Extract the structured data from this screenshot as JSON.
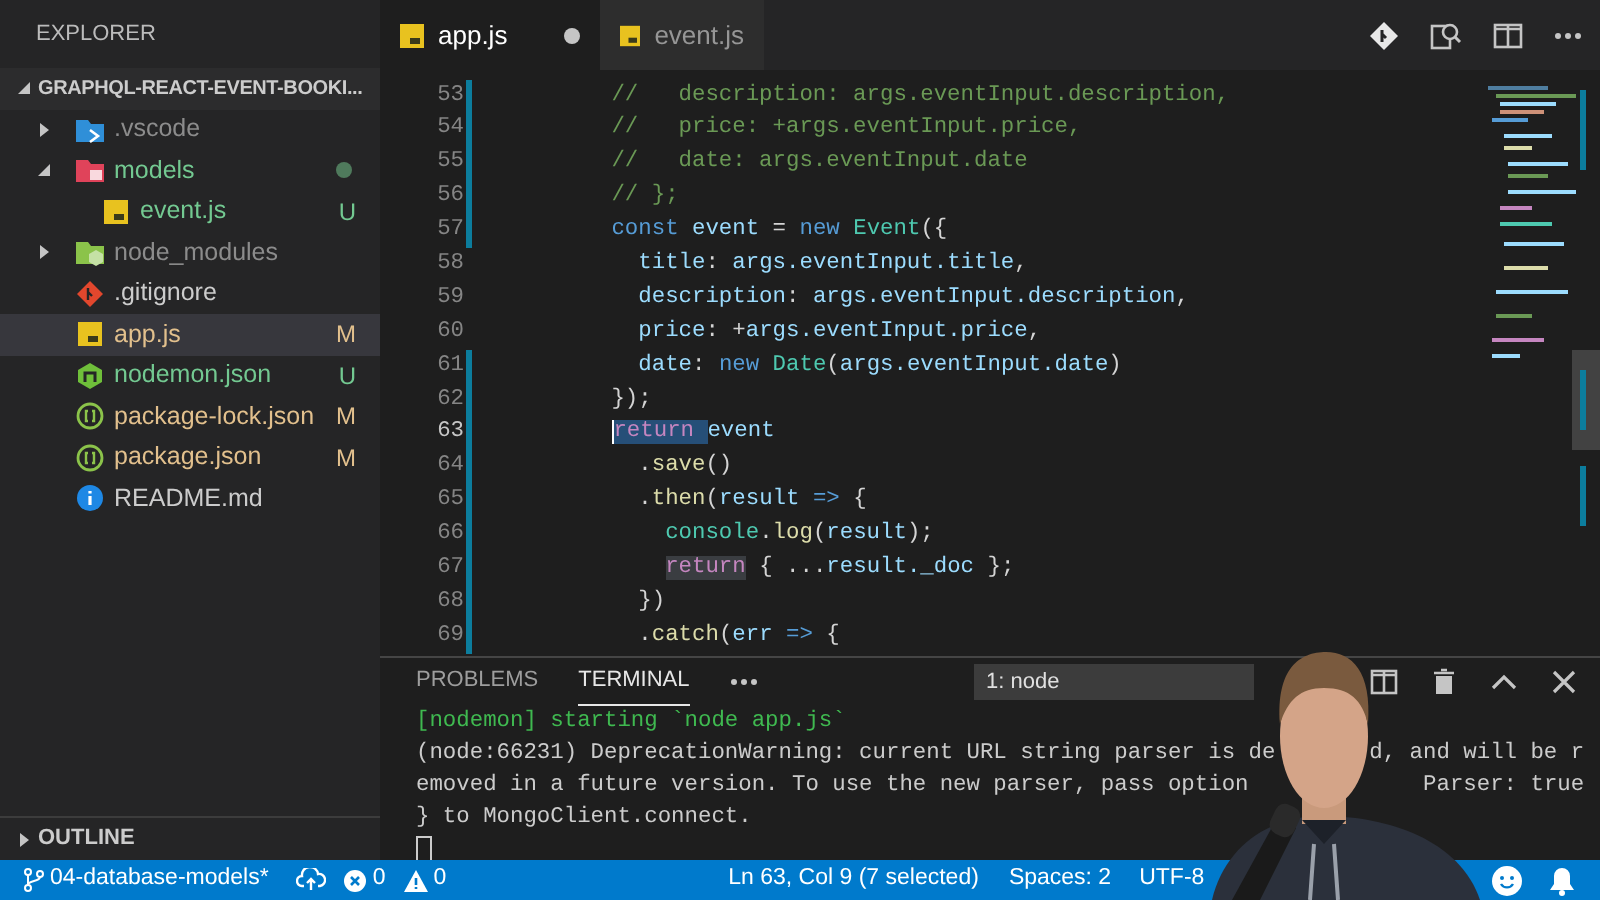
{
  "sidebar": {
    "title": "EXPLORER",
    "root": {
      "label": "GRAPHQL-REACT-EVENT-BOOKI...",
      "expanded": true
    },
    "items": [
      {
        "label": ".vscode",
        "expanded": false,
        "selected": false,
        "color": "#8c8c8c"
      },
      {
        "label": "models",
        "expanded": true,
        "selected": false,
        "color": "#73c991",
        "changed": true,
        "children": [
          {
            "label": "event.js",
            "selected": false,
            "color": "#73c991",
            "badge": "U"
          }
        ]
      },
      {
        "label": "node_modules",
        "expanded": false,
        "selected": false,
        "color": "#8c8c8c"
      },
      {
        "label": ".gitignore",
        "selected": false,
        "color": "#cccccc"
      },
      {
        "label": "app.js",
        "selected": true,
        "color": "#e2c08d",
        "badge": "M"
      },
      {
        "label": "nodemon.json",
        "selected": false,
        "color": "#73c991",
        "badge": "U"
      },
      {
        "label": "package-lock.json",
        "selected": false,
        "color": "#e2c08d",
        "badge": "M"
      },
      {
        "label": "package.json",
        "selected": false,
        "color": "#e2c08d",
        "badge": "M"
      },
      {
        "label": "README.md",
        "selected": false,
        "color": "#cccccc"
      }
    ],
    "outline": {
      "label": "OUTLINE",
      "expanded": false
    }
  },
  "tabs": [
    {
      "label": "app.js",
      "selected": true,
      "dirty": true
    },
    {
      "label": "event.js",
      "selected": false,
      "dirty": false
    }
  ],
  "code_lines": [
    {
      "number": "53",
      "modified": true,
      "current": false,
      "tokens": [
        {
          "kind": "comment",
          "text": "        //   description: args.eventInput.description,"
        }
      ]
    },
    {
      "number": "54",
      "modified": true,
      "current": false,
      "tokens": [
        {
          "kind": "comment",
          "text": "        //   price: +args.eventInput.price,"
        }
      ]
    },
    {
      "number": "55",
      "modified": true,
      "current": false,
      "tokens": [
        {
          "kind": "comment",
          "text": "        //   date: args.eventInput.date"
        }
      ]
    },
    {
      "number": "56",
      "modified": true,
      "current": false,
      "tokens": [
        {
          "kind": "comment",
          "text": "        // };"
        }
      ]
    },
    {
      "number": "57",
      "modified": true,
      "current": false,
      "tokens": [
        {
          "kind": "keyword",
          "text": "        const"
        },
        {
          "kind": "variable",
          "text": " event"
        },
        {
          "kind": "plain",
          "text": " = "
        },
        {
          "kind": "keyword",
          "text": "new"
        },
        {
          "kind": "class",
          "text": " Event"
        },
        {
          "kind": "plain",
          "text": "({"
        }
      ]
    },
    {
      "number": "58",
      "modified": false,
      "current": false,
      "tokens": [
        {
          "kind": "variable",
          "text": "          title"
        },
        {
          "kind": "plain",
          "text": ": "
        },
        {
          "kind": "variable",
          "text": "args.eventInput.title"
        },
        {
          "kind": "plain",
          "text": ","
        }
      ]
    },
    {
      "number": "59",
      "modified": false,
      "current": false,
      "tokens": [
        {
          "kind": "variable",
          "text": "          description"
        },
        {
          "kind": "plain",
          "text": ": "
        },
        {
          "kind": "variable",
          "text": "args.eventInput.description"
        },
        {
          "kind": "plain",
          "text": ","
        }
      ]
    },
    {
      "number": "60",
      "modified": false,
      "current": false,
      "tokens": [
        {
          "kind": "variable",
          "text": "          price"
        },
        {
          "kind": "plain",
          "text": ": +"
        },
        {
          "kind": "variable",
          "text": "args.eventInput.price"
        },
        {
          "kind": "plain",
          "text": ","
        }
      ]
    },
    {
      "number": "61",
      "modified": true,
      "current": false,
      "tokens": [
        {
          "kind": "variable",
          "text": "          date"
        },
        {
          "kind": "plain",
          "text": ": "
        },
        {
          "kind": "keyword",
          "text": "new"
        },
        {
          "kind": "class",
          "text": " Date"
        },
        {
          "kind": "plain",
          "text": "("
        },
        {
          "kind": "variable",
          "text": "args.eventInput.date"
        },
        {
          "kind": "plain",
          "text": ")"
        }
      ]
    },
    {
      "number": "62",
      "modified": true,
      "current": false,
      "tokens": [
        {
          "kind": "plain",
          "text": "        });"
        }
      ]
    },
    {
      "number": "63",
      "modified": true,
      "current": true,
      "tokens": [
        {
          "kind": "control",
          "text": "        return ",
          "in_selection": true
        },
        {
          "kind": "variable",
          "text": "event"
        }
      ]
    },
    {
      "number": "64",
      "modified": true,
      "current": false,
      "tokens": [
        {
          "kind": "plain",
          "text": "          ."
        },
        {
          "kind": "function",
          "text": "save"
        },
        {
          "kind": "plain",
          "text": "()"
        }
      ]
    },
    {
      "number": "65",
      "modified": true,
      "current": false,
      "tokens": [
        {
          "kind": "plain",
          "text": "          ."
        },
        {
          "kind": "function",
          "text": "then"
        },
        {
          "kind": "plain",
          "text": "("
        },
        {
          "kind": "variable",
          "text": "result"
        },
        {
          "kind": "keyword",
          "text": " =>"
        },
        {
          "kind": "plain",
          "text": " {"
        }
      ]
    },
    {
      "number": "66",
      "modified": true,
      "current": false,
      "tokens": [
        {
          "kind": "class",
          "text": "            console"
        },
        {
          "kind": "plain",
          "text": "."
        },
        {
          "kind": "function",
          "text": "log"
        },
        {
          "kind": "plain",
          "text": "("
        },
        {
          "kind": "variable",
          "text": "result"
        },
        {
          "kind": "plain",
          "text": ");"
        }
      ]
    },
    {
      "number": "67",
      "modified": true,
      "current": false,
      "tokens": [
        {
          "kind": "control",
          "text": "            return",
          "word_highlight": true
        },
        {
          "kind": "plain",
          "text": " { ..."
        },
        {
          "kind": "variable",
          "text": "result._doc"
        },
        {
          "kind": "plain",
          "text": " };"
        }
      ]
    },
    {
      "number": "68",
      "modified": true,
      "current": false,
      "tokens": [
        {
          "kind": "plain",
          "text": "          })"
        }
      ]
    },
    {
      "number": "69",
      "modified": true,
      "current": false,
      "tokens": [
        {
          "kind": "plain",
          "text": "          ."
        },
        {
          "kind": "function",
          "text": "catch"
        },
        {
          "kind": "plain",
          "text": "("
        },
        {
          "kind": "variable",
          "text": "err"
        },
        {
          "kind": "keyword",
          "text": " =>"
        },
        {
          "kind": "plain",
          "text": " {"
        }
      ]
    }
  ],
  "panel": {
    "tabs": [
      {
        "label": "PROBLEMS",
        "selected": false
      },
      {
        "label": "TERMINAL",
        "selected": true
      }
    ],
    "terminal_select": "1: node",
    "lines": [
      {
        "kind": "nodemon",
        "segments": [
          "[nodemon] starting `node app.js`"
        ]
      },
      {
        "kind": "plain",
        "segments": [
          "(node:66231) DeprecationWarning: current URL string parser is de",
          "d, and will be r"
        ]
      },
      {
        "kind": "plain",
        "segments": [
          "emoved in a future version. To use the new parser, pass option",
          "Parser: true"
        ]
      },
      {
        "kind": "plain",
        "segments": [
          "} to MongoClient.connect."
        ]
      }
    ]
  },
  "status_bar": {
    "branch": "04-database-models*",
    "errors": "0",
    "warnings": "0",
    "position": "Ln 63, Col 9 (7 selected)",
    "indentation": "Spaces: 2",
    "encoding": "UTF-8"
  }
}
